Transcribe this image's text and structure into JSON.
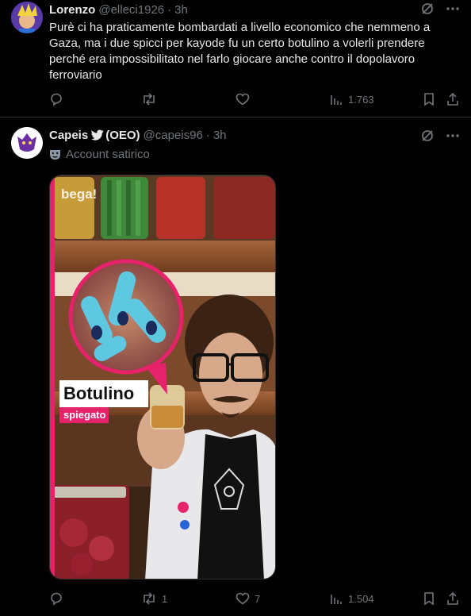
{
  "tweets": [
    {
      "author": "Lorenzo",
      "handle": "@elleci1926",
      "time": "3h",
      "text": "Purè ci ha praticamente bombardati a livello economico che nemmeno a Gaza, ma i due spicci per kayode fu un certo botulino a volerli prendere perché era impossibilitato nel farlo giocare anche contro il dopolavoro ferroviario",
      "replies": "",
      "retweets": "",
      "likes": "",
      "views": "1.763"
    },
    {
      "author": "Capeis",
      "author_suffix": "(OEO)",
      "handle": "@capeis96",
      "time": "3h",
      "label": "Account satirico",
      "media": {
        "brand": "bega!",
        "title": "Botulino",
        "subtitle": "spiegato"
      },
      "replies": "",
      "retweets": "1",
      "likes": "7",
      "views": "1.504"
    }
  ],
  "icons": {
    "grok": "grok-icon",
    "more": "more-icon",
    "reply": "reply-icon",
    "retweet": "retweet-icon",
    "like": "like-icon",
    "views": "views-icon",
    "bookmark": "bookmark-icon",
    "share": "share-icon",
    "bird": "bird-icon",
    "mask": "theater-mask-icon"
  },
  "colors": {
    "background": "#000000",
    "text": "#e7e9ea",
    "secondary": "#71767b",
    "divider": "#2f3336",
    "accent_pink": "#e6226b"
  }
}
